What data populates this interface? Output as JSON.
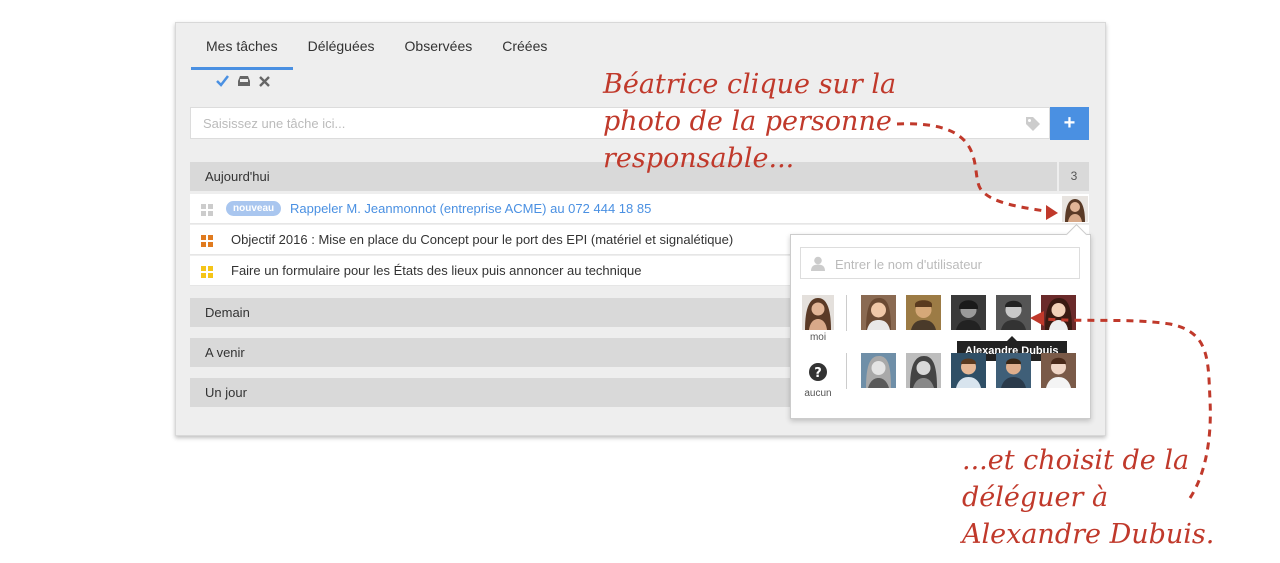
{
  "tabs": [
    {
      "label": "Mes tâches",
      "active": true
    },
    {
      "label": "Déléguées",
      "active": false
    },
    {
      "label": "Observées",
      "active": false
    },
    {
      "label": "Créées",
      "active": false
    }
  ],
  "task_input": {
    "placeholder": "Saisissez une tâche ici..."
  },
  "add_button": {
    "label": "+"
  },
  "sections": {
    "today": {
      "label": "Aujourd'hui",
      "count": "3"
    },
    "tomorrow": {
      "label": "Demain"
    },
    "upcoming": {
      "label": "A venir"
    },
    "someday": {
      "label": "Un jour"
    }
  },
  "tasks": [
    {
      "badge": "nouveau",
      "text": "Rappeler M. Jeanmonnot (entreprise ACME) au 072 444 18 85",
      "priority_color": "#cccccc"
    },
    {
      "text": "Objectif 2016 : Mise en place du Concept pour le port des EPI (matériel et signalétique)",
      "priority_color": "#e07b1f"
    },
    {
      "text": "Faire un formulaire pour les États des lieux puis annoncer au technique",
      "priority_color": "#f5c518"
    }
  ],
  "user_picker": {
    "search_placeholder": "Entrer le nom d'utilisateur",
    "me_label": "moi",
    "none_label": "aucun",
    "tooltip": "Alexandre Dubuis"
  },
  "annotations": {
    "first": [
      "Béatrice clique sur la",
      "photo de la personne",
      "responsable..."
    ],
    "second": [
      "...et choisit de la",
      "déléguer à",
      "Alexandre Dubuis."
    ]
  },
  "colors": {
    "accent": "#4a90e2",
    "annotation": "#c0392b"
  }
}
